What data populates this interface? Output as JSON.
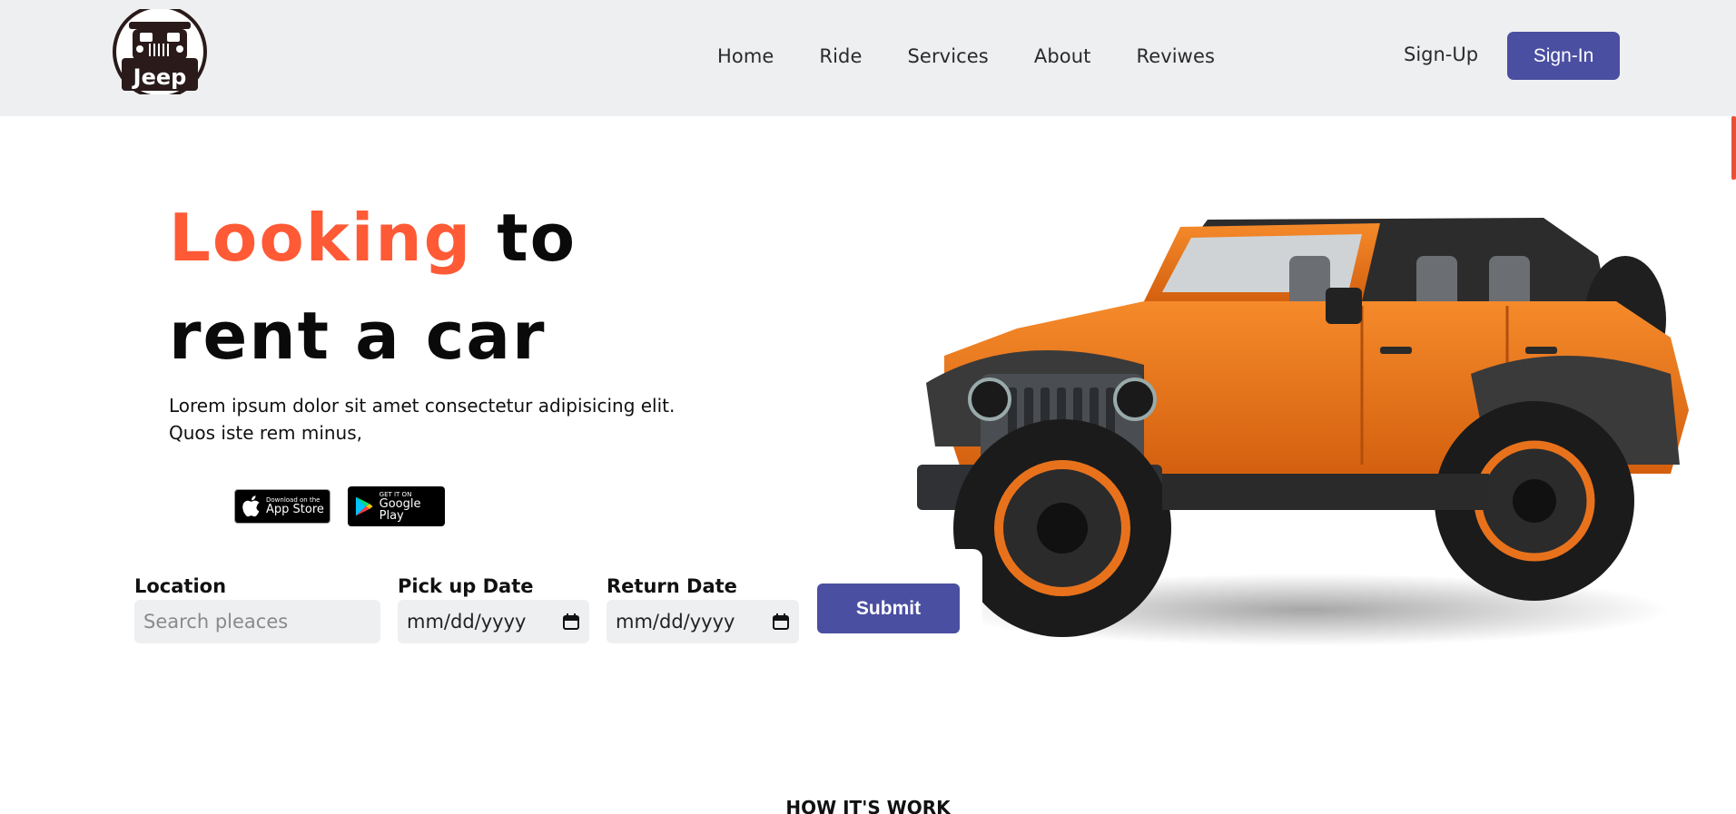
{
  "header": {
    "logo_text": "Jeep",
    "nav": [
      "Home",
      "Ride",
      "Services",
      "About",
      "Reviwes"
    ],
    "signup_label": "Sign-Up",
    "signin_label": "Sign-In"
  },
  "hero": {
    "title_accent": "Looking",
    "title_rest": " to",
    "title_line2": "rent a car",
    "description": "Lorem ipsum dolor sit amet consectetur adipisicing elit. Quos iste rem minus,"
  },
  "stores": {
    "apple_small": "Download on the",
    "apple_big": "App Store",
    "google_small": "GET IT ON",
    "google_big": "Google Play"
  },
  "form": {
    "location_label": "Location",
    "location_placeholder": "Search pleaces",
    "pickup_label": "Pick up Date",
    "pickup_value": "mm/dd/yyyy",
    "return_label": "Return Date",
    "return_value": "mm/dd/yyyy",
    "submit_label": "Submit"
  },
  "section": {
    "how_heading": "HOW IT'S WORK"
  },
  "colors": {
    "accent": "#ff5a36",
    "brand": "#4a4fa1",
    "header_bg": "#eeeff1",
    "car_body": "#e8721c"
  }
}
